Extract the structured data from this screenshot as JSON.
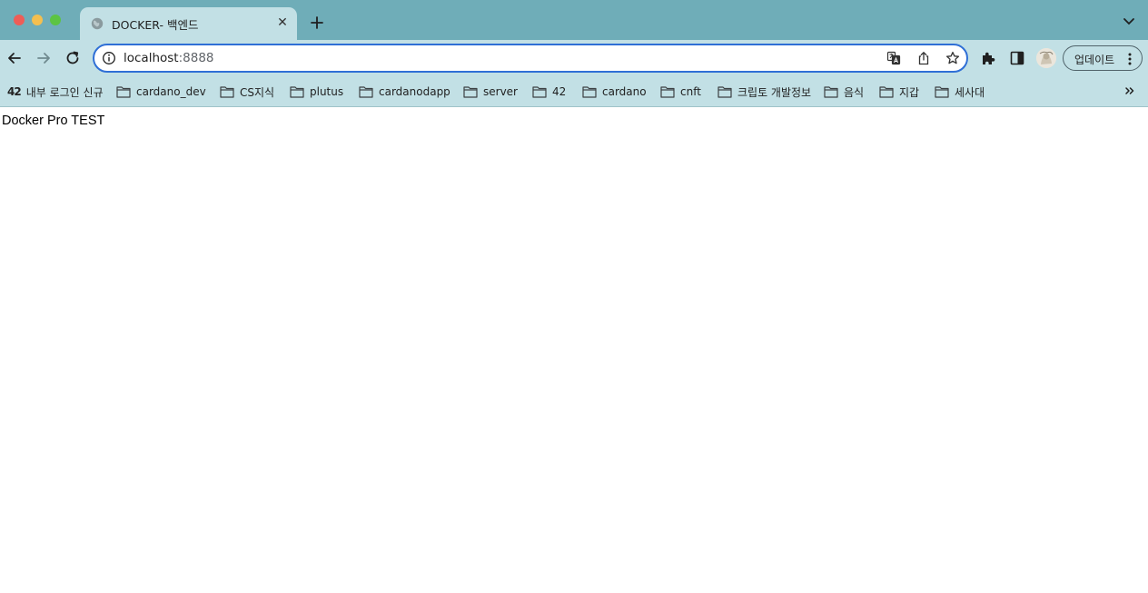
{
  "window": {
    "controls": [
      "close",
      "minimize",
      "zoom"
    ]
  },
  "tabs": [
    {
      "title": "DOCKER- 백엔드",
      "icon": "globe-icon",
      "active": true
    }
  ],
  "toolbar": {
    "url_host": "localhost",
    "url_port": ":8888",
    "update_label": "업데이트"
  },
  "bookmarks": [
    {
      "label": "내부 로그인 신규",
      "icon": "42-logo-icon"
    },
    {
      "label": "cardano_dev",
      "icon": "folder-icon"
    },
    {
      "label": "CS지식",
      "icon": "folder-icon"
    },
    {
      "label": "plutus",
      "icon": "folder-icon"
    },
    {
      "label": "cardanodapp",
      "icon": "folder-icon"
    },
    {
      "label": "server",
      "icon": "folder-icon"
    },
    {
      "label": "42",
      "icon": "folder-icon"
    },
    {
      "label": "cardano",
      "icon": "folder-icon"
    },
    {
      "label": "cnft",
      "icon": "folder-icon"
    },
    {
      "label": "크립토 개발정보",
      "icon": "folder-icon"
    },
    {
      "label": "음식",
      "icon": "folder-icon"
    },
    {
      "label": "지갑",
      "icon": "folder-icon"
    },
    {
      "label": "세사대",
      "icon": "folder-icon"
    }
  ],
  "bookmark_logo_text": "42",
  "page": {
    "text": "Docker Pro TEST"
  },
  "colors": {
    "tabstrip": "#6fadb8",
    "toolbar": "#c2e0e5",
    "omnibox_border": "#2f6fd6"
  }
}
